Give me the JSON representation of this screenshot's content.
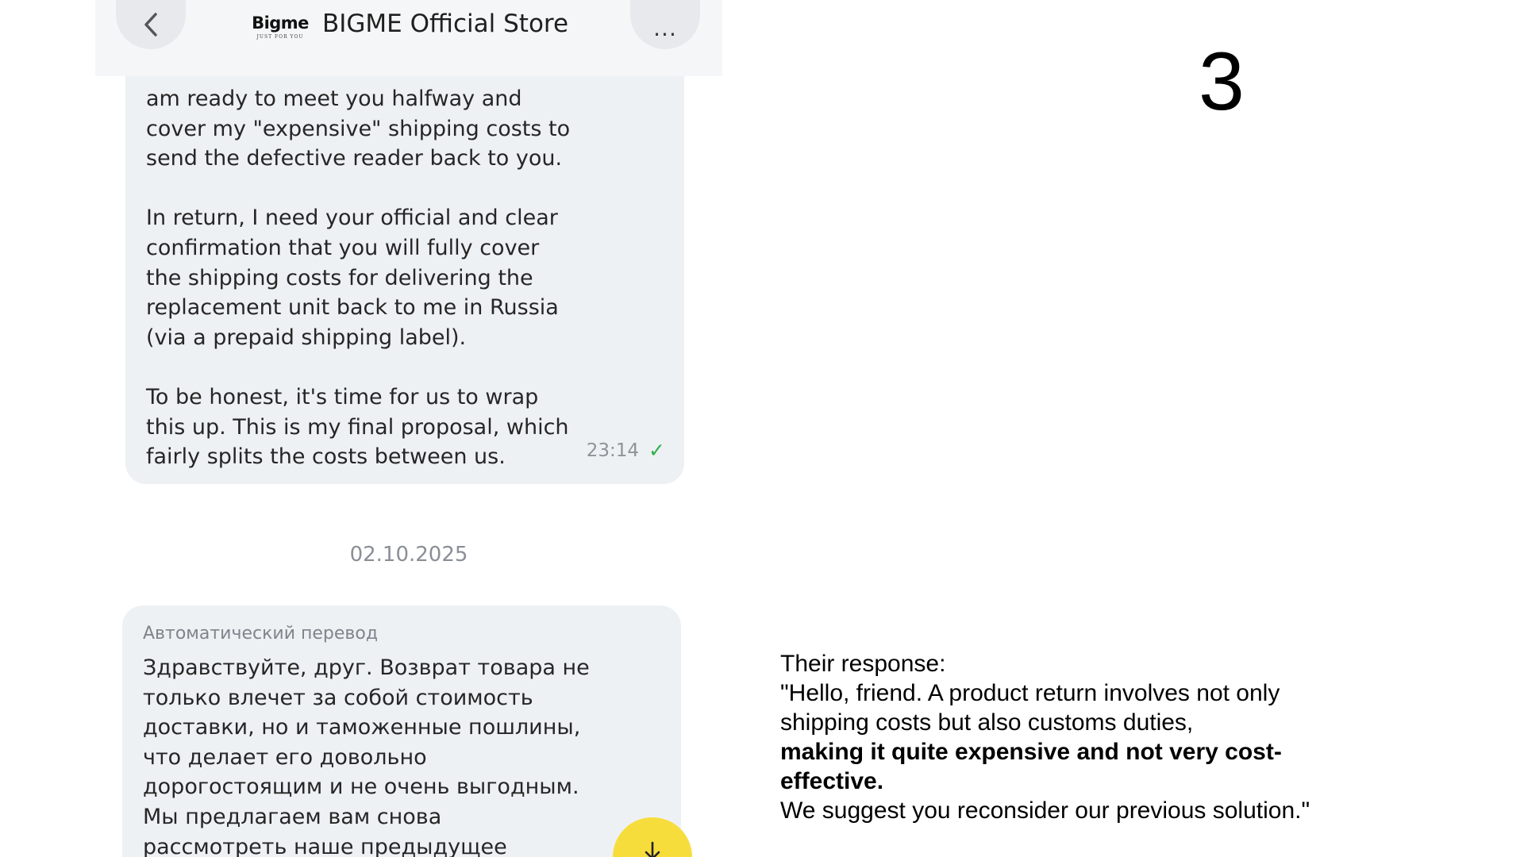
{
  "header": {
    "title": "BIGME Official Store",
    "logo_word": "Bigme",
    "logo_tagline": "JUST FOR YOU",
    "more_label": "..."
  },
  "outgoing_message": {
    "paragraphs": [
      [
        "am ready to meet you halfway and",
        "cover my \"expensive\" shipping costs to",
        "send the defective reader back to you."
      ],
      [
        "In return, I need your official and clear",
        "confirmation that you will fully cover",
        "the shipping costs for delivering the",
        "replacement unit back to me in Russia",
        "(via a prepaid shipping label)."
      ],
      [
        "To be honest, it's time for us to wrap",
        "this up. This is my final proposal, which",
        "fairly splits the costs between us."
      ]
    ],
    "time": "23:14",
    "status_icon": "read-check-icon",
    "status_color": "#2fb04a"
  },
  "date_separator": "02.10.2025",
  "incoming_message": {
    "auto_translation_label": "Автоматический перевод",
    "lines": [
      "Здравствуйте, друг. Возврат товара не",
      "только влечет за собой стоимость",
      "доставки, но и таможенные пошлины,",
      "что делает его довольно",
      "дорогостоящим и не очень выгодным.",
      "Мы предлагаем вам снова",
      "рассмотреть наше предыдущее"
    ]
  },
  "scroll_down_button": {
    "icon": "arrow-down-icon",
    "color": "#f6dd3c"
  },
  "page_number": "3",
  "caption": {
    "line1": "Their response:",
    "line2": "\"Hello, friend. A product return involves not only shipping costs but also customs duties,",
    "line3_bold": "making it quite expensive and not very cost-effective.",
    "line4": "We suggest you reconsider our previous solution.\""
  }
}
